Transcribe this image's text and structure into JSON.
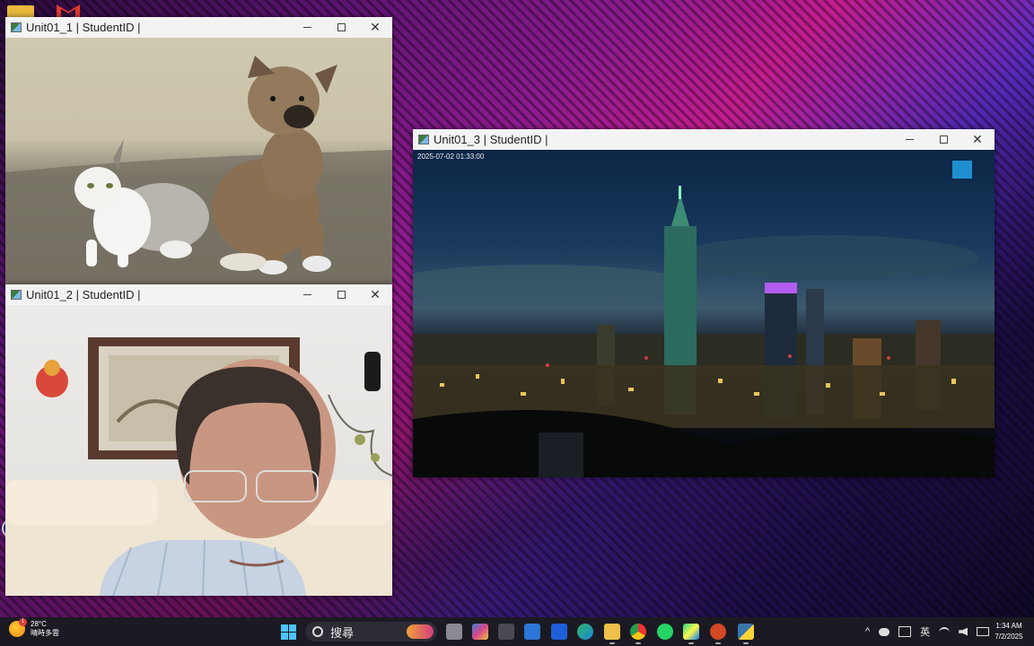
{
  "windows": [
    {
      "title": "Unit01_1 | StudentID |"
    },
    {
      "title": "Unit01_2 | StudentID |"
    },
    {
      "title": "Unit01_3 | StudentID |",
      "timestamp": "2025-07-02 01:33:00"
    }
  ],
  "controls": {
    "minimize": "—",
    "close": "✕"
  },
  "desktop_icons": [
    "folder-icon",
    "gmail-icon",
    "robot-icon"
  ],
  "taskbar": {
    "weather": {
      "temp": "28°C",
      "condition": "晴時多雲",
      "badge": "1"
    },
    "search_label": "搜尋",
    "apps": [
      "file-explorer",
      "copilot",
      "app-cube",
      "microsoft-store",
      "app-editor",
      "edge",
      "files",
      "chrome",
      "whatsapp",
      "pycharm",
      "powerpoint",
      "python"
    ],
    "tray": {
      "caret": "^",
      "ime": "英"
    },
    "clock": {
      "time": "1:34 AM",
      "date": "7/2/2025"
    }
  },
  "colors": {
    "accent": "#4cc2ff",
    "taskbar": "#1b1a22",
    "titlebar": "#f3f3f3"
  }
}
